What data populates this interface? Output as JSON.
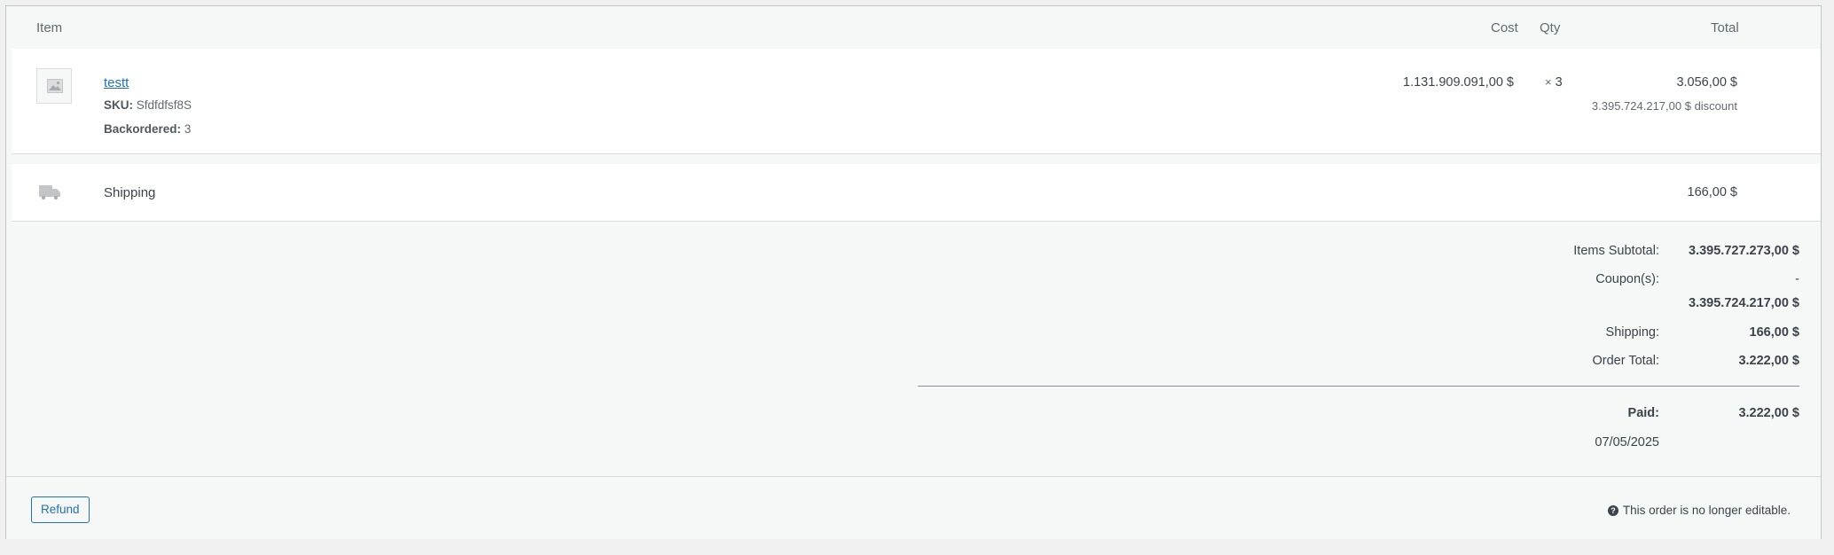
{
  "table": {
    "headers": {
      "item": "Item",
      "cost": "Cost",
      "qty": "Qty",
      "total": "Total"
    }
  },
  "line_item": {
    "name": "testt",
    "sku_label": "SKU:",
    "sku_value": "Sfdfdfsf8S",
    "backordered_label": "Backordered:",
    "backordered_value": "3",
    "cost": "1.131.909.091,00 $",
    "qty_prefix": "×",
    "qty": "3",
    "total": "3.056,00 $",
    "discount": "3.395.724.217,00 $ discount"
  },
  "shipping_line": {
    "label": "Shipping",
    "total": "166,00 $"
  },
  "totals": {
    "items_subtotal_label": "Items Subtotal:",
    "items_subtotal_value": "3.395.727.273,00 $",
    "coupons_label": "Coupon(s):",
    "coupons_value": "-",
    "discount_value": "3.395.724.217,00 $",
    "shipping_label": "Shipping:",
    "shipping_value": "166,00 $",
    "order_total_label": "Order Total:",
    "order_total_value": "3.222,00 $",
    "paid_label": "Paid:",
    "paid_value": "3.222,00 $",
    "paid_date": "07/05/2025"
  },
  "footer": {
    "refund_label": "Refund",
    "not_editable_note": "This order is no longer editable."
  },
  "icons": {
    "placeholder": "image-placeholder-icon",
    "shipping": "truck-icon",
    "help": "help-icon"
  },
  "colors": {
    "link": "#2271b1",
    "panel_bg": "#f6f7f7",
    "page_bg": "#f0f0f1"
  }
}
